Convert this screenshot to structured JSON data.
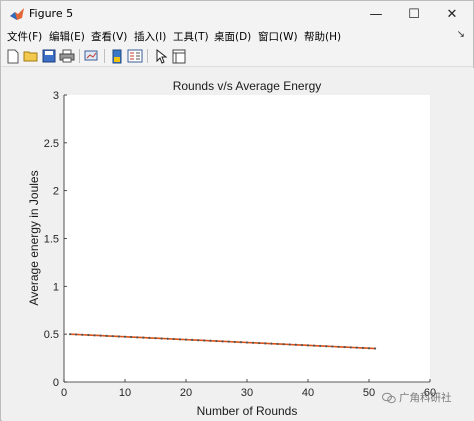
{
  "window": {
    "title": "Figure 5",
    "controls": {
      "minimize": "—",
      "maximize": "☐",
      "close": "✕"
    }
  },
  "menubar": {
    "items": [
      "文件(F)",
      "编辑(E)",
      "查看(V)",
      "插入(I)",
      "工具(T)",
      "桌面(D)",
      "窗口(W)",
      "帮助(H)"
    ],
    "overflow_arrow": "↘"
  },
  "toolbar": {
    "icons": [
      "new-figure-icon",
      "open-file-icon",
      "save-icon",
      "print-icon",
      "link-plot-icon",
      "colorbar-icon",
      "legend-icon",
      "pointer-icon",
      "property-inspector-icon"
    ]
  },
  "chart_data": {
    "type": "line",
    "title": "Rounds v/s Average Energy",
    "xlabel": "Number of Rounds",
    "ylabel": "Average energy in Joules",
    "xlim": [
      0,
      60
    ],
    "ylim": [
      0,
      3
    ],
    "xticks": [
      "0",
      "10",
      "20",
      "30",
      "40",
      "50",
      "60"
    ],
    "yticks": [
      "0",
      "0.5",
      "1",
      "1.5",
      "2",
      "2.5",
      "3"
    ],
    "grid": false,
    "series": [
      {
        "x": [
          1,
          2,
          3,
          4,
          5,
          6,
          7,
          8,
          9,
          10,
          11,
          12,
          13,
          14,
          15,
          16,
          17,
          18,
          19,
          20,
          21,
          22,
          23,
          24,
          25,
          26,
          27,
          28,
          29,
          30,
          31,
          32,
          33,
          34,
          35,
          36,
          37,
          38,
          39,
          40,
          41,
          42,
          43,
          44,
          45,
          46,
          47,
          48,
          49,
          50,
          51
        ],
        "y": [
          0.5,
          0.497,
          0.494,
          0.491,
          0.488,
          0.485,
          0.482,
          0.479,
          0.476,
          0.473,
          0.47,
          0.467,
          0.464,
          0.461,
          0.458,
          0.455,
          0.452,
          0.449,
          0.446,
          0.443,
          0.44,
          0.437,
          0.434,
          0.431,
          0.428,
          0.425,
          0.422,
          0.419,
          0.416,
          0.413,
          0.41,
          0.407,
          0.404,
          0.401,
          0.398,
          0.395,
          0.392,
          0.389,
          0.386,
          0.383,
          0.38,
          0.377,
          0.374,
          0.371,
          0.368,
          0.365,
          0.362,
          0.359,
          0.356,
          0.353,
          0.35
        ],
        "line_color": "#d95319",
        "marker_color": "#555555"
      }
    ]
  },
  "watermark": {
    "text": "广角科研社"
  }
}
